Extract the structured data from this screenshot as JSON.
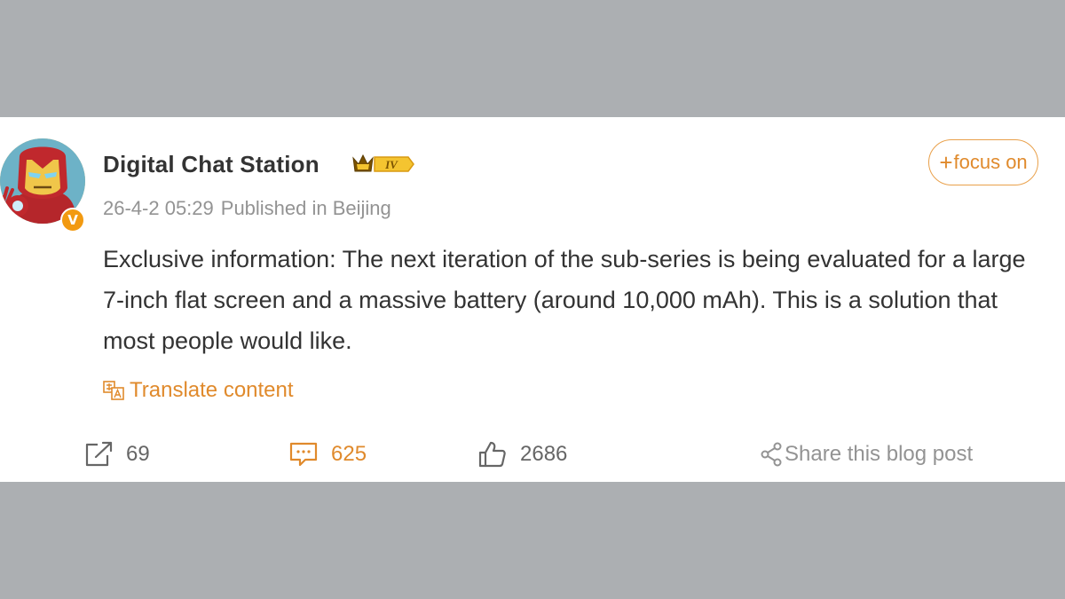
{
  "post": {
    "username": "Digital Chat Station",
    "level_badge": "IV",
    "verified_badge": "V",
    "timestamp": "26-4-2 05:29",
    "location": "Published in Beijing",
    "follow_label": "focus on",
    "content": "Exclusive information: The next iteration of the sub-series is being evaluated for a large 7-inch flat screen and a massive battery (around 10,000 mAh). This is a solution that most people would like.",
    "translate_label": "Translate content"
  },
  "actions": {
    "repost_count": "69",
    "comment_count": "625",
    "like_count": "2686",
    "share_label": "Share this blog post"
  },
  "colors": {
    "accent": "#e08a2c",
    "backdrop": "#acafb2",
    "card": "#ffffff",
    "text": "#333333",
    "muted": "#939393"
  },
  "icons": {
    "avatar": "iron-man-avatar",
    "level": "crown-icon",
    "repost": "repost-icon",
    "comment": "comment-icon",
    "like": "thumbs-up-icon",
    "share": "share-icon",
    "translate": "translate-icon"
  }
}
